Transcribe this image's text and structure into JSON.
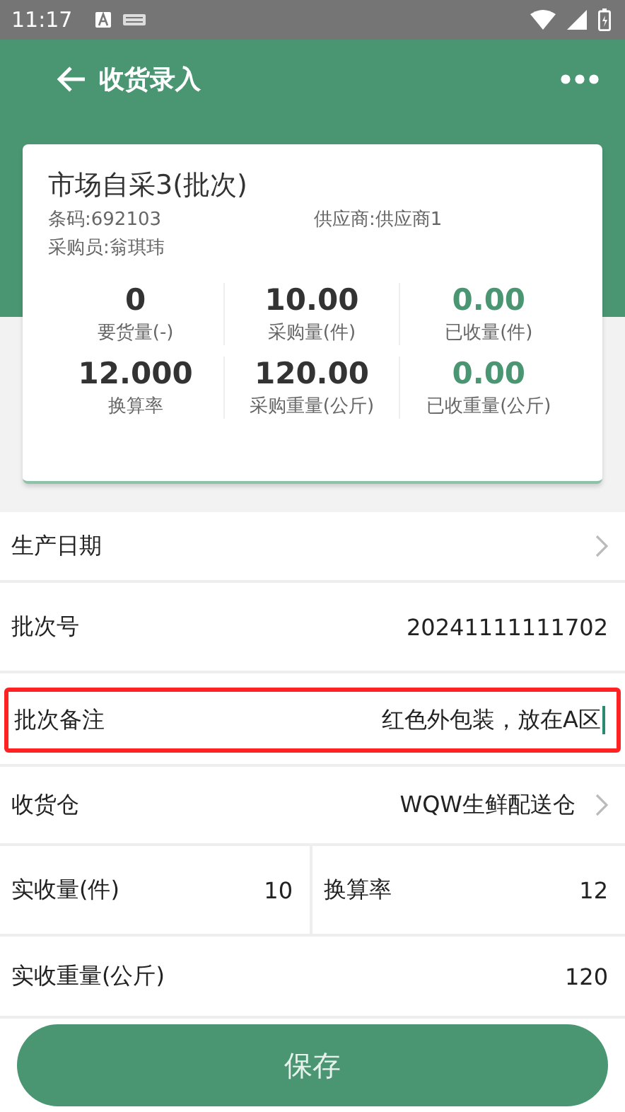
{
  "status_bar": {
    "time": "11:17"
  },
  "app_bar": {
    "title": "收货录入"
  },
  "product": {
    "name": "市场自采3(批次)",
    "barcode": "条码:692103",
    "supplier": "供应商:供应商1",
    "buyer": "采购员:翁琪玮",
    "stats": [
      {
        "value": "0",
        "label": "要货量(-)",
        "color": "#333333"
      },
      {
        "value": "10.00",
        "label": "采购量(件)",
        "color": "#333333"
      },
      {
        "value": "0.00",
        "label": "已收量(件)",
        "color": "#4a9673"
      },
      {
        "value": "12.000",
        "label": "换算率",
        "color": "#333333"
      },
      {
        "value": "120.00",
        "label": "采购重量(公斤)",
        "color": "#333333"
      },
      {
        "value": "0.00",
        "label": "已收重量(公斤)",
        "color": "#4a9673"
      }
    ]
  },
  "form": [
    {
      "kind": "link",
      "label": "生产日期",
      "highlighted": false
    },
    {
      "kind": "text",
      "label": "批次号",
      "value": "20241111111702",
      "highlighted": false
    },
    {
      "kind": "input",
      "label": "批次备注",
      "value": "红色外包装，放在A区",
      "highlighted": true
    },
    {
      "kind": "link",
      "label": "收货仓",
      "value": "WQW生鲜配送仓",
      "highlighted": false
    },
    {
      "kind": "pair",
      "cells": [
        {
          "label": "实收量(件)",
          "value": "10"
        },
        {
          "label": "换算率",
          "value": "12"
        }
      ]
    },
    {
      "kind": "text",
      "label": "实收重量(公斤)",
      "value": "120",
      "highlighted": false
    }
  ],
  "save_button": {
    "label": "保存"
  }
}
